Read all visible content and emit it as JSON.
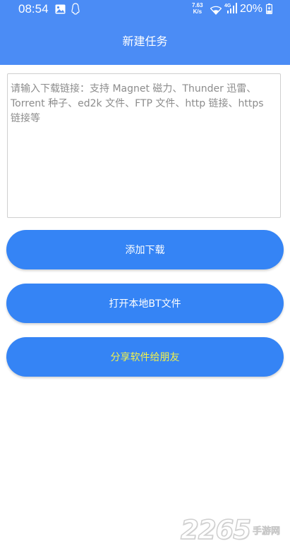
{
  "status_bar": {
    "time": "08:54",
    "net_speed_value": "7.63",
    "net_speed_unit": "K/s",
    "battery": "20%",
    "icons": [
      "image-icon",
      "qq-penguin-icon",
      "wifi-icon",
      "4g-signal-icon",
      "battery-charging-icon"
    ]
  },
  "header": {
    "title": "新建任务"
  },
  "input": {
    "placeholder": "请输入下载链接：支持 Magnet 磁力、Thunder 迅雷、Torrent 种子、ed2k 文件、FTP 文件、http 链接、https 链接等",
    "value": ""
  },
  "buttons": {
    "add_download": "添加下载",
    "open_local_bt": "打开本地BT文件",
    "share_app": "分享软件给朋友"
  },
  "colors": {
    "header_bg": "#4b8cf5",
    "button_bg": "#3584f5",
    "button_text": "#ffffff",
    "share_text": "#f2f24a"
  },
  "watermark": {
    "brand": "2265",
    "suffix": "手游网"
  }
}
